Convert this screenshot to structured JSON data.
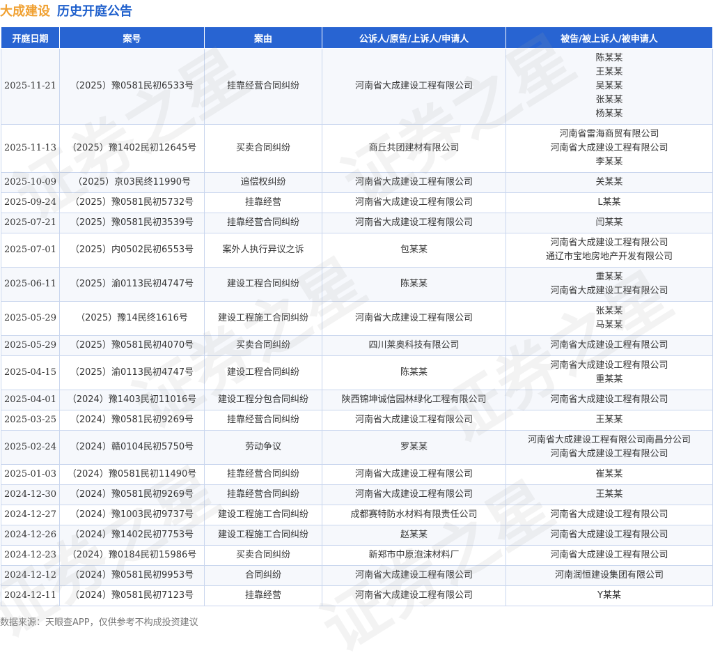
{
  "header": {
    "company": "大成建设",
    "title": "历史开庭公告"
  },
  "table": {
    "columns": [
      "开庭日期",
      "案号",
      "案由",
      "公诉人/原告/上诉人/申请人",
      "被告/被上诉人/被申请人"
    ],
    "rows": [
      {
        "date": "2025-11-21",
        "case": "（2025）豫0581民初6533号",
        "cause": "挂靠经营合同纠纷",
        "plaintiff": [
          "河南省大成建设工程有限公司"
        ],
        "defendant": [
          "陈某某",
          "王某某",
          "吴某某",
          "张某某",
          "杨某某"
        ]
      },
      {
        "date": "2025-11-13",
        "case": "（2025）豫1402民初12645号",
        "cause": "买卖合同纠纷",
        "plaintiff": [
          "商丘共团建材有限公司"
        ],
        "defendant": [
          "河南省雷海商贸有限公司",
          "河南省大成建设工程有限公司",
          "李某某"
        ]
      },
      {
        "date": "2025-10-09",
        "case": "（2025）京03民终11990号",
        "cause": "追偿权纠纷",
        "plaintiff": [
          "河南省大成建设工程有限公司"
        ],
        "defendant": [
          "关某某"
        ]
      },
      {
        "date": "2025-09-24",
        "case": "（2025）豫0581民初5732号",
        "cause": "挂靠经营",
        "plaintiff": [
          "河南省大成建设工程有限公司"
        ],
        "defendant": [
          "L某某"
        ]
      },
      {
        "date": "2025-07-21",
        "case": "（2025）豫0581民初3539号",
        "cause": "挂靠经营合同纠纷",
        "plaintiff": [
          "河南省大成建设工程有限公司"
        ],
        "defendant": [
          "闫某某"
        ]
      },
      {
        "date": "2025-07-01",
        "case": "（2025）内0502民初6553号",
        "cause": "案外人执行异议之诉",
        "plaintiff": [
          "包某某"
        ],
        "defendant": [
          "河南省大成建设工程有限公司",
          "通辽市宝地房地产开发有限公司"
        ]
      },
      {
        "date": "2025-06-11",
        "case": "（2025）渝0113民初4747号",
        "cause": "建设工程合同纠纷",
        "plaintiff": [
          "陈某某"
        ],
        "defendant": [
          "重某某",
          "河南省大成建设工程有限公司"
        ]
      },
      {
        "date": "2025-05-29",
        "case": "（2025）豫14民终1616号",
        "cause": "建设工程施工合同纠纷",
        "plaintiff": [
          "河南省大成建设工程有限公司"
        ],
        "defendant": [
          "张某某",
          "马某某"
        ]
      },
      {
        "date": "2025-05-29",
        "case": "（2025）豫0581民初4070号",
        "cause": "买卖合同纠纷",
        "plaintiff": [
          "四川莱奥科技有限公司"
        ],
        "defendant": [
          "河南省大成建设工程有限公司"
        ]
      },
      {
        "date": "2025-04-15",
        "case": "（2025）渝0113民初4747号",
        "cause": "建设工程合同纠纷",
        "plaintiff": [
          "陈某某"
        ],
        "defendant": [
          "河南省大成建设工程有限公司",
          "重某某"
        ]
      },
      {
        "date": "2025-04-01",
        "case": "（2024）豫1403民初11016号",
        "cause": "建设工程分包合同纠纷",
        "plaintiff": [
          "陕西锦坤诚信园林绿化工程有限公司"
        ],
        "defendant": [
          "河南省大成建设工程有限公司"
        ]
      },
      {
        "date": "2025-03-25",
        "case": "（2024）豫0581民初9269号",
        "cause": "挂靠经营合同纠纷",
        "plaintiff": [
          "河南省大成建设工程有限公司"
        ],
        "defendant": [
          "王某某"
        ]
      },
      {
        "date": "2025-02-24",
        "case": "（2024）赣0104民初5750号",
        "cause": "劳动争议",
        "plaintiff": [
          "罗某某"
        ],
        "defendant": [
          "河南省大成建设工程有限公司南昌分公司",
          "河南省大成建设工程有限公司"
        ]
      },
      {
        "date": "2025-01-03",
        "case": "（2024）豫0581民初11490号",
        "cause": "挂靠经营合同纠纷",
        "plaintiff": [
          "河南省大成建设工程有限公司"
        ],
        "defendant": [
          "崔某某"
        ]
      },
      {
        "date": "2024-12-30",
        "case": "（2024）豫0581民初9269号",
        "cause": "挂靠经营合同纠纷",
        "plaintiff": [
          "河南省大成建设工程有限公司"
        ],
        "defendant": [
          "王某某"
        ]
      },
      {
        "date": "2024-12-27",
        "case": "（2024）豫1003民初9737号",
        "cause": "建设工程施工合同纠纷",
        "plaintiff": [
          "成都赛特防水材料有限责任公司"
        ],
        "defendant": [
          "河南省大成建设工程有限公司"
        ]
      },
      {
        "date": "2024-12-26",
        "case": "（2024）豫1402民初7753号",
        "cause": "建设工程施工合同纠纷",
        "plaintiff": [
          "赵某某"
        ],
        "defendant": [
          "河南省大成建设工程有限公司"
        ]
      },
      {
        "date": "2024-12-23",
        "case": "（2024）豫0184民初15986号",
        "cause": "买卖合同纠纷",
        "plaintiff": [
          "新郑市中原泡沫材料厂"
        ],
        "defendant": [
          "河南省大成建设工程有限公司"
        ]
      },
      {
        "date": "2024-12-12",
        "case": "（2024）豫0581民初9953号",
        "cause": "合同纠纷",
        "plaintiff": [
          "河南省大成建设工程有限公司"
        ],
        "defendant": [
          "河南润恒建设集团有限公司"
        ]
      },
      {
        "date": "2024-12-11",
        "case": "（2024）豫0581民初7123号",
        "cause": "挂靠经营",
        "plaintiff": [
          "河南省大成建设工程有限公司"
        ],
        "defendant": [
          "Y某某"
        ]
      }
    ]
  },
  "footer": {
    "source": "数据来源：天眼查APP，仅供参考不构成投资建议"
  },
  "watermark": {
    "text": "证券之星"
  },
  "colors": {
    "header_bg": "#2864d2",
    "company": "#f0a030",
    "title": "#1e5fcc"
  }
}
